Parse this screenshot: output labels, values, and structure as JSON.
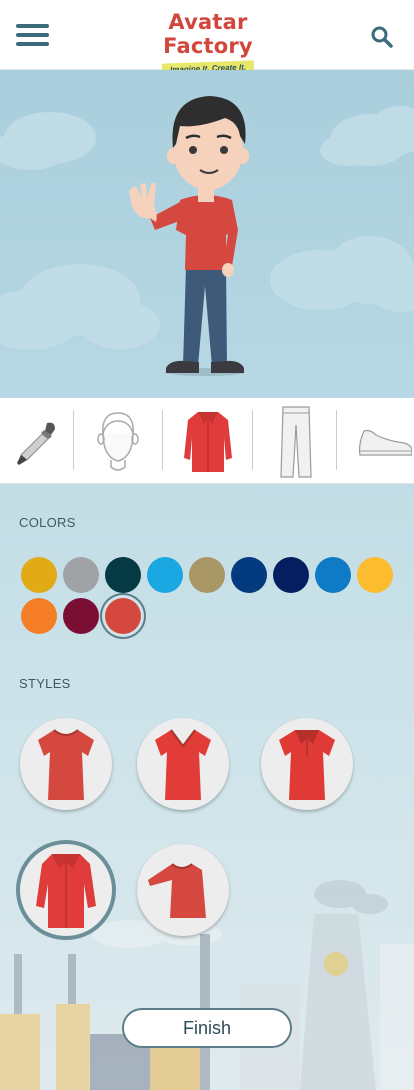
{
  "header": {
    "app_title": "Avatar Factory",
    "tagline": "Imagine It. Create It."
  },
  "categories": [
    {
      "name": "eyedropper",
      "icon": "eyedropper-icon",
      "selected": false
    },
    {
      "name": "head",
      "icon": "head-icon",
      "selected": false
    },
    {
      "name": "shirt",
      "icon": "shirt-icon",
      "selected": true
    },
    {
      "name": "pants",
      "icon": "pants-icon",
      "selected": false
    },
    {
      "name": "shoes",
      "icon": "shoe-icon",
      "selected": false
    }
  ],
  "colors_section": {
    "label": "COLORS",
    "swatches": [
      {
        "color": "#e0ab17",
        "selected": false
      },
      {
        "color": "#a0a3a5",
        "selected": false
      },
      {
        "color": "#053a45",
        "selected": false
      },
      {
        "color": "#1aa7e2",
        "selected": false
      },
      {
        "color": "#a99765",
        "selected": false
      },
      {
        "color": "#043a7e",
        "selected": false
      },
      {
        "color": "#041e60",
        "selected": false
      },
      {
        "color": "#0f7ac6",
        "selected": false
      },
      {
        "color": "#fdbb30",
        "selected": false
      },
      {
        "color": "#f57e27",
        "selected": false
      },
      {
        "color": "#7a0e33",
        "selected": false
      },
      {
        "color": "#d44840",
        "selected": true
      }
    ]
  },
  "styles_section": {
    "label": "STYLES",
    "options": [
      {
        "name": "t-shirt",
        "selected": false
      },
      {
        "name": "v-neck-tee",
        "selected": false
      },
      {
        "name": "collared-tee",
        "selected": false
      },
      {
        "name": "button-shirt",
        "selected": true
      },
      {
        "name": "longsleeve",
        "selected": false
      }
    ]
  },
  "finish_button": {
    "label": "Finish"
  },
  "colors": {
    "shirt": "#d44840",
    "accent": "#3a6b7b"
  }
}
